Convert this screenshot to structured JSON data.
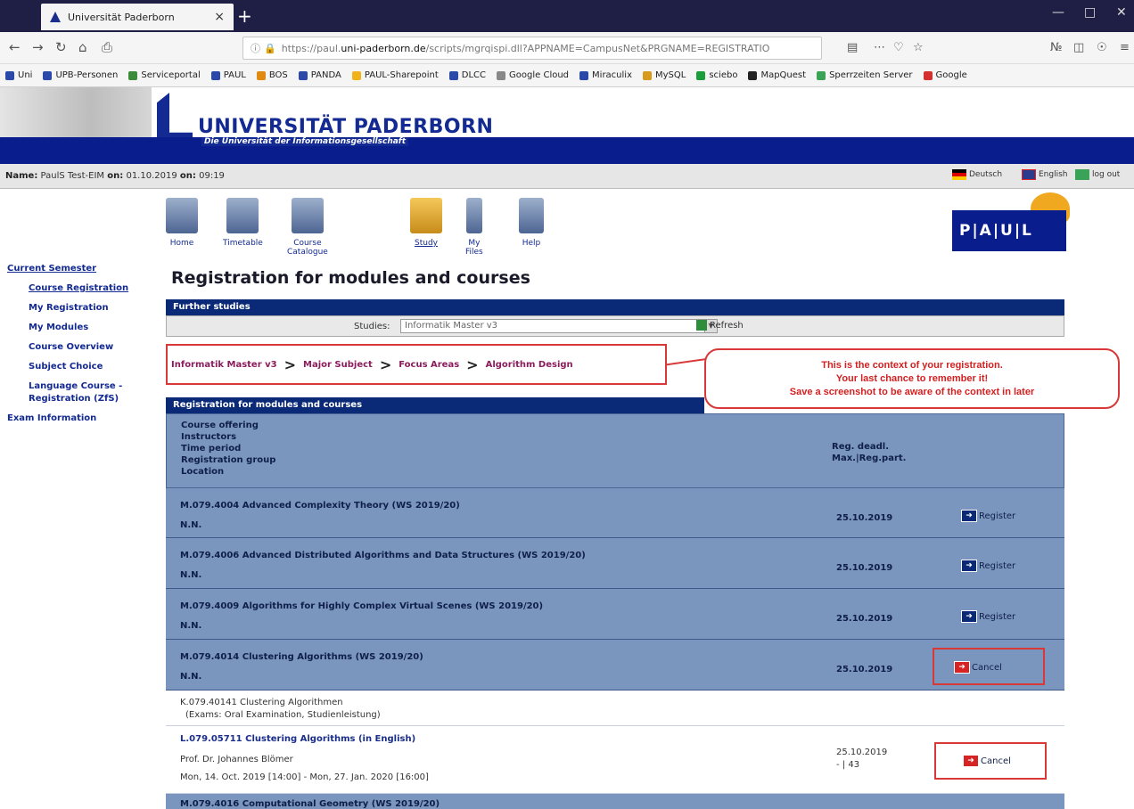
{
  "browser": {
    "tab_title": "Universität Paderborn",
    "tab_close": "×",
    "new_tab": "+",
    "url_prefix": "https://paul.",
    "url_host": "uni-paderborn.de",
    "url_rest": "/scripts/mgrqispi.dll?APPNAME=CampusNet&PRGNAME=REGISTRATIO",
    "bookmarks": [
      "Uni",
      "UPB-Personen",
      "Serviceportal",
      "PAUL",
      "BOS",
      "PANDA",
      "PAUL-Sharepoint",
      "DLCC",
      "Google Cloud",
      "Miraculix",
      "MySQL",
      "sciebo",
      "MapQuest",
      "Sperrzeiten Server",
      "Google"
    ]
  },
  "header": {
    "university": "UNIVERSITÄT PADERBORN",
    "slogan": "Die Universität der Informationsgesellschaft"
  },
  "userbar": {
    "name_label": "Name:",
    "name": "PaulS Test-EIM",
    "on_label1": "on:",
    "date": "01.10.2019",
    "on_label2": "on:",
    "time": "09:19",
    "lang_de": "Deutsch",
    "lang_en": "English",
    "logout": "log out"
  },
  "sidebar": {
    "top": "Current Semester",
    "items": [
      "Course Registration",
      "My Registration",
      "My Modules",
      "Course Overview",
      "Subject Choice",
      "Language Course -",
      "Registration (ZfS)"
    ],
    "exam": "Exam Information"
  },
  "toolbar": {
    "items": [
      "Home",
      "Timetable",
      "Course Catalogue",
      "Study",
      "My Files",
      "Help"
    ]
  },
  "logo_text": "P|A|U|L",
  "page_title": "Registration for modules and courses",
  "further": {
    "header": "Further studies",
    "studies_label": "Studies:",
    "studies_value": "Informatik Master v3",
    "refresh": "Refresh"
  },
  "breadcrumb": [
    "Informatik Master v3",
    "Major Subject",
    "Focus Areas",
    "Algorithm Design"
  ],
  "breadcrumb_sep": ">",
  "callout": {
    "line1": "This is the context of your registration.",
    "line2": "Your last chance to remember it!",
    "line3": "Save a screenshot to be aware of the context in later"
  },
  "table": {
    "header": "Registration for modules and courses",
    "col_left": [
      "Course offering",
      "Instructors",
      "Time period",
      "Registration group",
      "Location"
    ],
    "col_right": [
      "Reg. deadl.",
      "Max.|Reg.part."
    ],
    "rows": [
      {
        "title": "M.079.4004 Advanced Complexity Theory (WS 2019/20)",
        "sub": "N.N.",
        "date": "25.10.2019",
        "action": "Register"
      },
      {
        "title": "M.079.4006 Advanced Distributed Algorithms and Data Structures (WS 2019/20)",
        "sub": "N.N.",
        "date": "25.10.2019",
        "action": "Register"
      },
      {
        "title": "M.079.4009 Algorithms for Highly Complex Virtual Scenes (WS 2019/20)",
        "sub": "N.N.",
        "date": "25.10.2019",
        "action": "Register"
      },
      {
        "title": "M.079.4014 Clustering Algorithms (WS 2019/20)",
        "sub": "N.N.",
        "date": "25.10.2019",
        "action": "Cancel"
      }
    ],
    "exam_row": {
      "line1": "K.079.40141 Clustering Algorithmen",
      "line2": "(Exams: Oral Examination, Studienleistung)"
    },
    "course_row": {
      "title": "L.079.05711 Clustering Algorithms (in English)",
      "instructor": "Prof. Dr. Johannes Blömer",
      "period": "Mon, 14. Oct. 2019 [14:00] - Mon, 27. Jan. 2020 [16:00]",
      "date": "25.10.2019",
      "part": "- | 43",
      "action": "Cancel"
    },
    "last_row_title": "M.079.4016 Computational Geometry (WS 2019/20)"
  }
}
